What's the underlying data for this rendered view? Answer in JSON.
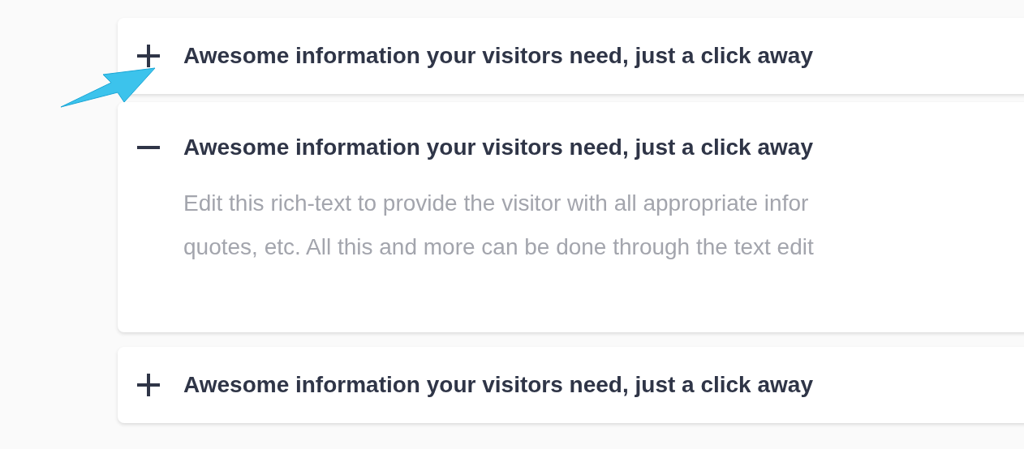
{
  "faq_items": [
    {
      "question": "Awesome information your visitors need, just a click away",
      "expanded": false
    },
    {
      "question": "Awesome information your visitors need, just a click away",
      "expanded": true,
      "answer_lines": [
        "Edit this rich-text to provide the visitor with all appropriate infor",
        "quotes, etc. All this and more can be done through the text edit"
      ]
    },
    {
      "question": "Awesome information your visitors need, just a click away",
      "expanded": false
    }
  ]
}
